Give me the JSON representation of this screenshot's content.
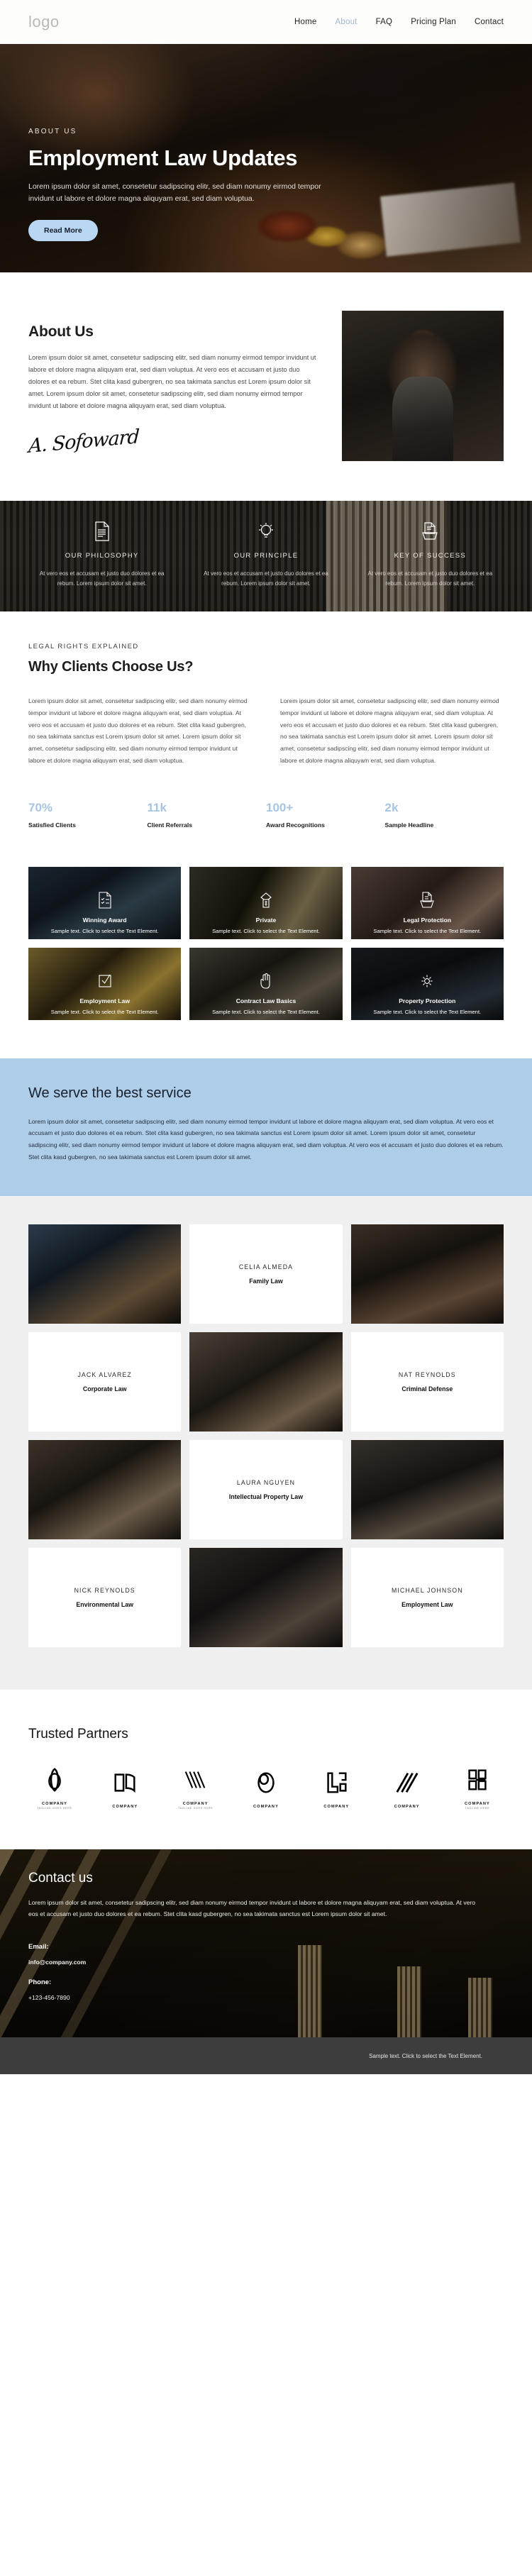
{
  "header": {
    "logo": "logo",
    "nav": [
      {
        "label": "Home",
        "active": false
      },
      {
        "label": "About",
        "active": true
      },
      {
        "label": "FAQ",
        "active": false
      },
      {
        "label": "Pricing Plan",
        "active": false
      },
      {
        "label": "Contact",
        "active": false
      }
    ]
  },
  "hero": {
    "eyebrow": "ABOUT US",
    "title": "Employment Law Updates",
    "text": "Lorem ipsum dolor sit amet, consetetur sadipscing elitr, sed diam nonumy eirmod tempor invidunt ut labore et dolore magna aliquyam erat, sed diam voluptua.",
    "button": "Read More"
  },
  "about": {
    "heading": "About Us",
    "paragraph": "Lorem ipsum dolor sit amet, consetetur sadipscing elitr, sed diam nonumy eirmod tempor invidunt ut labore et dolore magna aliquyam erat, sed diam voluptua. At vero eos et accusam et justo duo dolores et ea rebum. Stet clita kasd gubergren, no sea takimata sanctus est Lorem ipsum dolor sit amet. Lorem ipsum dolor sit amet, consetetur sadipscing elitr, sed diam nonumy eirmod tempor invidunt ut labore et dolore magna aliquyam erat, sed diam voluptua.",
    "signature": "A. Sofoward"
  },
  "features": [
    {
      "icon": "document-lines-icon",
      "title": "OUR PHILOSOPHY",
      "text": "At vero eos et accusam et justo duo dolores et ea rebum. Lorem ipsum dolor sit amet."
    },
    {
      "icon": "lightbulb-icon",
      "title": "OUR PRINCIPLE",
      "text": "At vero eos et accusam et justo duo dolores et ea rebum. Lorem ipsum dolor sit amet."
    },
    {
      "icon": "file-folder-icon",
      "title": "KEY OF SUCCESS",
      "text": "At vero eos et accusam et justo duo dolores et ea rebum. Lorem ipsum dolor sit amet."
    }
  ],
  "why": {
    "eyebrow": "LEGAL RIGHTS EXPLAINED",
    "heading": "Why Clients Choose Us?",
    "col_left": "Lorem ipsum dolor sit amet, consetetur sadipscing elitr, sed diam nonumy eirmod tempor invidunt ut labore et dolore magna aliquyam erat, sed diam voluptua. At vero eos et accusam et justo duo dolores et ea rebum. Stet clita kasd gubergren, no sea takimata sanctus est Lorem ipsum dolor sit amet. Lorem ipsum dolor sit amet, consetetur sadipscing elitr, sed diam nonumy eirmod tempor invidunt ut labore et dolore magna aliquyam erat, sed diam voluptua.",
    "col_right": "Lorem ipsum dolor sit amet, consetetur sadipscing elitr, sed diam nonumy eirmod tempor invidunt ut labore et dolore magna aliquyam erat, sed diam voluptua. At vero eos et accusam et justo duo dolores et ea rebum. Stet clita kasd gubergren, no sea takimata sanctus est Lorem ipsum dolor sit amet. Lorem ipsum dolor sit amet, consetetur sadipscing elitr, sed diam nonumy eirmod tempor invidunt ut labore et dolore magna aliquyam erat, sed diam voluptua."
  },
  "stats": [
    {
      "number": "70%",
      "label": "Satisfied Clients"
    },
    {
      "number": "11k",
      "label": "Client Referrals"
    },
    {
      "number": "100+",
      "label": "Award Recognitions"
    },
    {
      "number": "2k",
      "label": "Sample Headline"
    }
  ],
  "tiles": [
    {
      "icon": "checklist-document-icon",
      "title": "Winning Award",
      "sub": "Sample text. Click to select the Text Element."
    },
    {
      "icon": "money-hand-icon",
      "title": "Private",
      "sub": "Sample text. Click to select the Text Element."
    },
    {
      "icon": "file-folder-icon",
      "title": "Legal Protection",
      "sub": "Sample text. Click to select the Text Element."
    },
    {
      "icon": "checkbox-check-icon",
      "title": "Employment Law",
      "sub": "Sample text. Click to select the Text Element."
    },
    {
      "icon": "hand-stop-icon",
      "title": "Contract Law Basics",
      "sub": "Sample text. Click to select the Text Element."
    },
    {
      "icon": "gear-icon",
      "title": "Property Protection",
      "sub": "Sample text. Click to select the Text Element."
    }
  ],
  "serve": {
    "heading": "We serve the best service",
    "paragraph": "Lorem ipsum dolor sit amet, consetetur sadipscing elitr, sed diam nonumy eirmod tempor invidunt ut labore et dolore magna aliquyam erat, sed diam voluptua. At vero eos et accusam et justo duo dolores et ea rebum. Stet clita kasd gubergren, no sea takimata sanctus est Lorem ipsum dolor sit amet. Lorem ipsum dolor sit amet, consetetur sadipscing elitr, sed diam nonumy eirmod tempor invidunt ut labore et dolore magna aliquyam erat, sed diam voluptua. At vero eos et accusam et justo duo dolores et ea rebum. Stet clita kasd gubergren, no sea takimata sanctus est Lorem ipsum dolor sit amet."
  },
  "team": [
    {
      "name": "CELIA ALMEDA",
      "role": "Family Law"
    },
    {
      "name": "JACK ALVAREZ",
      "role": "Corporate Law"
    },
    {
      "name": "NAT REYNOLDS",
      "role": "Criminal Defense"
    },
    {
      "name": "LAURA NGUYEN",
      "role": "Intellectual Property Law"
    },
    {
      "name": "NICK REYNOLDS",
      "role": "Environmental Law"
    },
    {
      "name": "MICHAEL JOHNSON",
      "role": "Employment Law"
    }
  ],
  "partners": {
    "heading": "Trusted Partners",
    "logos": [
      {
        "icon": "ring-knot-logo",
        "name": "COMPANY",
        "tagline": "TAGLINE GOES HERE"
      },
      {
        "icon": "open-book-logo",
        "name": "COMPANY",
        "tagline": ""
      },
      {
        "icon": "chevron-v-logo",
        "name": "COMPANY",
        "tagline": "TAGLINE GOES HERE"
      },
      {
        "icon": "double-oval-logo",
        "name": "COMPANY",
        "tagline": ""
      },
      {
        "icon": "corner-blocks-logo",
        "name": "COMPANY",
        "tagline": ""
      },
      {
        "icon": "slash-stripes-logo",
        "name": "COMPANY",
        "tagline": ""
      },
      {
        "icon": "bracket-grid-logo",
        "name": "COMPANY",
        "tagline": "TAGLINE HERE"
      }
    ]
  },
  "contact": {
    "heading": "Contact us",
    "paragraph": "Lorem ipsum dolor sit amet, consetetur sadipscing elitr, sed diam nonumy eirmod tempor invidunt ut labore et dolore magna aliquyam erat, sed diam voluptua. At vero eos et accusam et justo duo dolores et ea rebum. Stet clita kasd gubergren, no sea takimata sanctus est Lorem ipsum dolor sit amet.",
    "email_label": "Email:",
    "email_value": "info@company.com",
    "phone_label": "Phone:",
    "phone_value": "+123-456-7890"
  },
  "footer": {
    "text": "Sample text. Click to select the Text Element."
  },
  "colors": {
    "accent_blue": "#aecde9",
    "stat_blue": "#a7c4e0",
    "nav_active": "#9fb7cf",
    "dark": "#121110",
    "footer_bg": "#3d3d3d"
  }
}
